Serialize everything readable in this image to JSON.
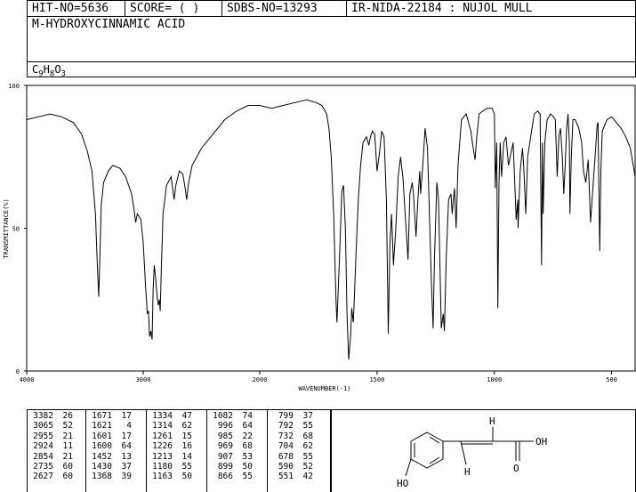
{
  "header": {
    "hit_no": "HIT-NO=5636",
    "score": "SCORE=  (   )",
    "sdbs_no": "SDBS-NO=13293",
    "ir_code": "IR-NIDA-22184 : NUJOL MULL",
    "compound_name": "M-HYDROXYCINNAMIC ACID",
    "formula_parts": [
      {
        "t": "C",
        "sub": false
      },
      {
        "t": "9",
        "sub": true
      },
      {
        "t": "H",
        "sub": false
      },
      {
        "t": "8",
        "sub": true
      },
      {
        "t": "O",
        "sub": false
      },
      {
        "t": "3",
        "sub": true
      }
    ]
  },
  "chart_data": {
    "type": "line",
    "xlabel": "WAVENUMBER(-1)",
    "ylabel": "TRANSMITTANCE(%)",
    "x_reversed": true,
    "xlim": [
      4000,
      400
    ],
    "ylim": [
      0,
      100
    ],
    "x_ticks": [
      "4000",
      "3000",
      "2000",
      "1500",
      "1000",
      "500"
    ],
    "y_ticks": [
      "100",
      "50",
      "0"
    ],
    "series": [
      {
        "color": "#000000",
        "points": [
          [
            4000,
            88
          ],
          [
            3900,
            89
          ],
          [
            3800,
            90
          ],
          [
            3700,
            89
          ],
          [
            3600,
            87
          ],
          [
            3530,
            83
          ],
          [
            3480,
            77
          ],
          [
            3440,
            70
          ],
          [
            3410,
            55
          ],
          [
            3395,
            38
          ],
          [
            3382,
            26
          ],
          [
            3372,
            40
          ],
          [
            3360,
            58
          ],
          [
            3340,
            66
          ],
          [
            3300,
            70
          ],
          [
            3260,
            72
          ],
          [
            3200,
            71
          ],
          [
            3150,
            68
          ],
          [
            3100,
            62
          ],
          [
            3080,
            57
          ],
          [
            3065,
            52
          ],
          [
            3050,
            55
          ],
          [
            3020,
            53
          ],
          [
            3000,
            45
          ],
          [
            2980,
            30
          ],
          [
            2965,
            20
          ],
          [
            2955,
            21
          ],
          [
            2945,
            12
          ],
          [
            2935,
            14
          ],
          [
            2924,
            11
          ],
          [
            2915,
            28
          ],
          [
            2905,
            37
          ],
          [
            2895,
            33
          ],
          [
            2880,
            26
          ],
          [
            2870,
            23
          ],
          [
            2860,
            25
          ],
          [
            2854,
            21
          ],
          [
            2845,
            35
          ],
          [
            2830,
            55
          ],
          [
            2800,
            65
          ],
          [
            2760,
            68
          ],
          [
            2735,
            60
          ],
          [
            2720,
            65
          ],
          [
            2690,
            70
          ],
          [
            2660,
            69
          ],
          [
            2640,
            64
          ],
          [
            2627,
            60
          ],
          [
            2610,
            66
          ],
          [
            2580,
            72
          ],
          [
            2500,
            78
          ],
          [
            2400,
            83
          ],
          [
            2300,
            88
          ],
          [
            2200,
            91
          ],
          [
            2100,
            93
          ],
          [
            2000,
            93
          ],
          [
            1950,
            92
          ],
          [
            1900,
            93
          ],
          [
            1850,
            94
          ],
          [
            1800,
            95
          ],
          [
            1760,
            94
          ],
          [
            1735,
            93
          ],
          [
            1715,
            90
          ],
          [
            1705,
            85
          ],
          [
            1695,
            75
          ],
          [
            1685,
            55
          ],
          [
            1675,
            25
          ],
          [
            1671,
            17
          ],
          [
            1660,
            40
          ],
          [
            1650,
            63
          ],
          [
            1643,
            65
          ],
          [
            1635,
            50
          ],
          [
            1628,
            20
          ],
          [
            1621,
            4
          ],
          [
            1613,
            12
          ],
          [
            1608,
            22
          ],
          [
            1601,
            17
          ],
          [
            1597,
            25
          ],
          [
            1590,
            40
          ],
          [
            1580,
            60
          ],
          [
            1570,
            72
          ],
          [
            1560,
            80
          ],
          [
            1545,
            82
          ],
          [
            1535,
            79
          ],
          [
            1528,
            82
          ],
          [
            1520,
            84
          ],
          [
            1510,
            83
          ],
          [
            1500,
            70
          ],
          [
            1490,
            76
          ],
          [
            1480,
            84
          ],
          [
            1470,
            82
          ],
          [
            1460,
            60
          ],
          [
            1452,
            13
          ],
          [
            1445,
            45
          ],
          [
            1438,
            55
          ],
          [
            1430,
            37
          ],
          [
            1420,
            50
          ],
          [
            1410,
            68
          ],
          [
            1400,
            75
          ],
          [
            1390,
            68
          ],
          [
            1380,
            55
          ],
          [
            1368,
            39
          ],
          [
            1360,
            62
          ],
          [
            1350,
            66
          ],
          [
            1345,
            62
          ],
          [
            1334,
            47
          ],
          [
            1326,
            60
          ],
          [
            1318,
            70
          ],
          [
            1314,
            62
          ],
          [
            1305,
            72
          ],
          [
            1295,
            85
          ],
          [
            1285,
            78
          ],
          [
            1275,
            50
          ],
          [
            1268,
            30
          ],
          [
            1261,
            15
          ],
          [
            1255,
            40
          ],
          [
            1245,
            66
          ],
          [
            1238,
            60
          ],
          [
            1226,
            15
          ],
          [
            1218,
            20
          ],
          [
            1213,
            14
          ],
          [
            1205,
            40
          ],
          [
            1195,
            60
          ],
          [
            1185,
            62
          ],
          [
            1180,
            55
          ],
          [
            1170,
            64
          ],
          [
            1163,
            50
          ],
          [
            1155,
            72
          ],
          [
            1140,
            88
          ],
          [
            1120,
            90
          ],
          [
            1100,
            84
          ],
          [
            1092,
            79
          ],
          [
            1082,
            74
          ],
          [
            1075,
            82
          ],
          [
            1065,
            90
          ],
          [
            1050,
            91
          ],
          [
            1030,
            92
          ],
          [
            1010,
            92
          ],
          [
            1000,
            90
          ],
          [
            996,
            64
          ],
          [
            990,
            80
          ],
          [
            985,
            22
          ],
          [
            980,
            66
          ],
          [
            975,
            80
          ],
          [
            969,
            68
          ],
          [
            960,
            80
          ],
          [
            950,
            82
          ],
          [
            940,
            72
          ],
          [
            930,
            76
          ],
          [
            920,
            80
          ],
          [
            907,
            53
          ],
          [
            900,
            60
          ],
          [
            899,
            50
          ],
          [
            890,
            70
          ],
          [
            880,
            78
          ],
          [
            875,
            72
          ],
          [
            866,
            55
          ],
          [
            858,
            75
          ],
          [
            845,
            82
          ],
          [
            830,
            90
          ],
          [
            815,
            91
          ],
          [
            805,
            90
          ],
          [
            799,
            37
          ],
          [
            795,
            80
          ],
          [
            792,
            55
          ],
          [
            785,
            80
          ],
          [
            775,
            88
          ],
          [
            760,
            90
          ],
          [
            748,
            89
          ],
          [
            740,
            88
          ],
          [
            732,
            68
          ],
          [
            725,
            82
          ],
          [
            718,
            85
          ],
          [
            710,
            75
          ],
          [
            704,
            62
          ],
          [
            698,
            72
          ],
          [
            692,
            85
          ],
          [
            686,
            90
          ],
          [
            680,
            80
          ],
          [
            678,
            55
          ],
          [
            672,
            75
          ],
          [
            665,
            88
          ],
          [
            655,
            88
          ],
          [
            640,
            85
          ],
          [
            628,
            80
          ],
          [
            620,
            70
          ],
          [
            610,
            66
          ],
          [
            600,
            74
          ],
          [
            590,
            52
          ],
          [
            580,
            64
          ],
          [
            570,
            76
          ],
          [
            562,
            86
          ],
          [
            558,
            87
          ],
          [
            551,
            42
          ],
          [
            546,
            70
          ],
          [
            540,
            84
          ],
          [
            520,
            88
          ],
          [
            500,
            89
          ],
          [
            480,
            87
          ],
          [
            460,
            85
          ],
          [
            440,
            82
          ],
          [
            420,
            78
          ],
          [
            400,
            68
          ]
        ]
      }
    ]
  },
  "peak_table": [
    [
      [
        "3382",
        "26"
      ],
      [
        "3065",
        "52"
      ],
      [
        "2955",
        "21"
      ],
      [
        "2924",
        "11"
      ],
      [
        "2854",
        "21"
      ],
      [
        "2735",
        "60"
      ],
      [
        "2627",
        "60"
      ]
    ],
    [
      [
        "1671",
        "17"
      ],
      [
        "1621",
        "4"
      ],
      [
        "1601",
        "17"
      ],
      [
        "1600",
        "64"
      ],
      [
        "1452",
        "13"
      ],
      [
        "1430",
        "37"
      ],
      [
        "1368",
        "39"
      ]
    ],
    [
      [
        "1334",
        "47"
      ],
      [
        "1314",
        "62"
      ],
      [
        "1261",
        "15"
      ],
      [
        "1226",
        "16"
      ],
      [
        "1213",
        "14"
      ],
      [
        "1180",
        "55"
      ],
      [
        "1163",
        "50"
      ]
    ],
    [
      [
        "1082",
        "74"
      ],
      [
        "996",
        "64"
      ],
      [
        "985",
        "22"
      ],
      [
        "969",
        "68"
      ],
      [
        "907",
        "53"
      ],
      [
        "899",
        "50"
      ],
      [
        "866",
        "55"
      ]
    ],
    [
      [
        "799",
        "37"
      ],
      [
        "792",
        "55"
      ],
      [
        "732",
        "68"
      ],
      [
        "704",
        "62"
      ],
      [
        "678",
        "55"
      ],
      [
        "590",
        "52"
      ],
      [
        "551",
        "42"
      ]
    ]
  ],
  "structure": {
    "labels": {
      "h_top": "H",
      "h_bottom": "H",
      "oh_right": "OH",
      "o_bottom": "O",
      "ho_left": "HO"
    }
  }
}
